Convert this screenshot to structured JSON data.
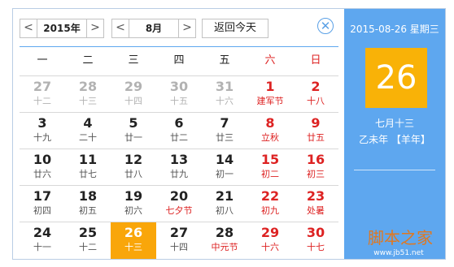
{
  "toolbar": {
    "year_label": "2015年",
    "month_label": "8月",
    "today_label": "返回今天",
    "prev_glyph": "<",
    "next_glyph": ">",
    "close_glyph": "✕"
  },
  "weekdays": [
    "一",
    "二",
    "三",
    "四",
    "五",
    "六",
    "日"
  ],
  "weeks": [
    [
      {
        "day": "27",
        "lunar": "十二",
        "other": true
      },
      {
        "day": "28",
        "lunar": "十三",
        "other": true
      },
      {
        "day": "29",
        "lunar": "十四",
        "other": true
      },
      {
        "day": "30",
        "lunar": "十五",
        "other": true
      },
      {
        "day": "31",
        "lunar": "十六",
        "other": true
      },
      {
        "day": "1",
        "lunar": "建军节",
        "festival": true
      },
      {
        "day": "2",
        "lunar": "十八"
      }
    ],
    [
      {
        "day": "3",
        "lunar": "十九"
      },
      {
        "day": "4",
        "lunar": "二十"
      },
      {
        "day": "5",
        "lunar": "廿一"
      },
      {
        "day": "6",
        "lunar": "廿二"
      },
      {
        "day": "7",
        "lunar": "廿三"
      },
      {
        "day": "8",
        "lunar": "立秋",
        "festival": true
      },
      {
        "day": "9",
        "lunar": "廿五"
      }
    ],
    [
      {
        "day": "10",
        "lunar": "廿六"
      },
      {
        "day": "11",
        "lunar": "廿七"
      },
      {
        "day": "12",
        "lunar": "廿八"
      },
      {
        "day": "13",
        "lunar": "廿九"
      },
      {
        "day": "14",
        "lunar": "初一"
      },
      {
        "day": "15",
        "lunar": "初二"
      },
      {
        "day": "16",
        "lunar": "初三"
      }
    ],
    [
      {
        "day": "17",
        "lunar": "初四"
      },
      {
        "day": "18",
        "lunar": "初五"
      },
      {
        "day": "19",
        "lunar": "初六"
      },
      {
        "day": "20",
        "lunar": "七夕节",
        "festival": true
      },
      {
        "day": "21",
        "lunar": "初八"
      },
      {
        "day": "22",
        "lunar": "初九"
      },
      {
        "day": "23",
        "lunar": "处暑",
        "festival": true
      }
    ],
    [
      {
        "day": "24",
        "lunar": "十一"
      },
      {
        "day": "25",
        "lunar": "十二"
      },
      {
        "day": "26",
        "lunar": "十三",
        "selected": true
      },
      {
        "day": "27",
        "lunar": "十四"
      },
      {
        "day": "28",
        "lunar": "中元节",
        "festival": true
      },
      {
        "day": "29",
        "lunar": "十六"
      },
      {
        "day": "30",
        "lunar": "十七"
      }
    ]
  ],
  "panel": {
    "date_title": "2015-08-26 星期三",
    "big_day": "26",
    "lunar_month_day": "七月十三",
    "ganzhi": "乙未年 【羊年】"
  },
  "watermark": {
    "text": "脚本之家",
    "url": "www.jb51.net"
  },
  "colors": {
    "accent": "#5ea7ef",
    "selected": "#f9a60a",
    "weekend": "#dd2222",
    "other_month": "#b2b2b2"
  }
}
